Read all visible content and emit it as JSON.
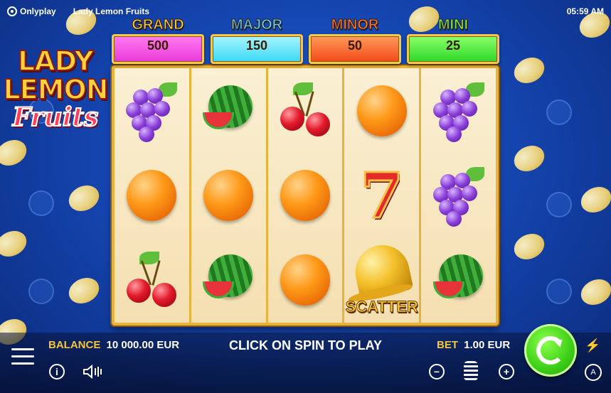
{
  "topbar": {
    "brand": "Onlyplay",
    "game_title": "Lady Lemon Fruits",
    "clock": "05:59 AM"
  },
  "logo": {
    "line1": "LADY",
    "line2": "LEMON",
    "line3": "Fruits"
  },
  "jackpots": [
    {
      "label": "GRAND",
      "value": "500",
      "label_color": "#ffd23a",
      "box_color": "#e83ad8"
    },
    {
      "label": "MAJOR",
      "value": "150",
      "label_color": "#5ad8ff",
      "box_color": "#3ad8f4"
    },
    {
      "label": "MINOR",
      "value": "50",
      "label_color": "#ff7a3a",
      "box_color": "#f24a18"
    },
    {
      "label": "MINI",
      "value": "25",
      "label_color": "#7aff4a",
      "box_color": "#2ed82a"
    }
  ],
  "reels": [
    [
      "grapes",
      "orange",
      "cherries"
    ],
    [
      "watermelon",
      "orange",
      "watermelon"
    ],
    [
      "cherries",
      "orange",
      "orange"
    ],
    [
      "orange",
      "seven",
      "bell-scatter"
    ],
    [
      "grapes",
      "grapes",
      "watermelon"
    ]
  ],
  "scatter_label": "SCATTER",
  "bottombar": {
    "balance_label": "BALANCE",
    "balance_value": "10 000.00 EUR",
    "status": "CLICK ON SPIN TO PLAY",
    "bet_label": "BET",
    "bet_value": "1.00 EUR",
    "info_glyph": "i",
    "minus_glyph": "−",
    "plus_glyph": "+",
    "turbo_glyph": "⚡",
    "auto_glyph": "A"
  },
  "colors": {
    "accent_gold": "#f7c53a",
    "spin_green": "#3fd018",
    "background_blue": "#1341a8"
  }
}
